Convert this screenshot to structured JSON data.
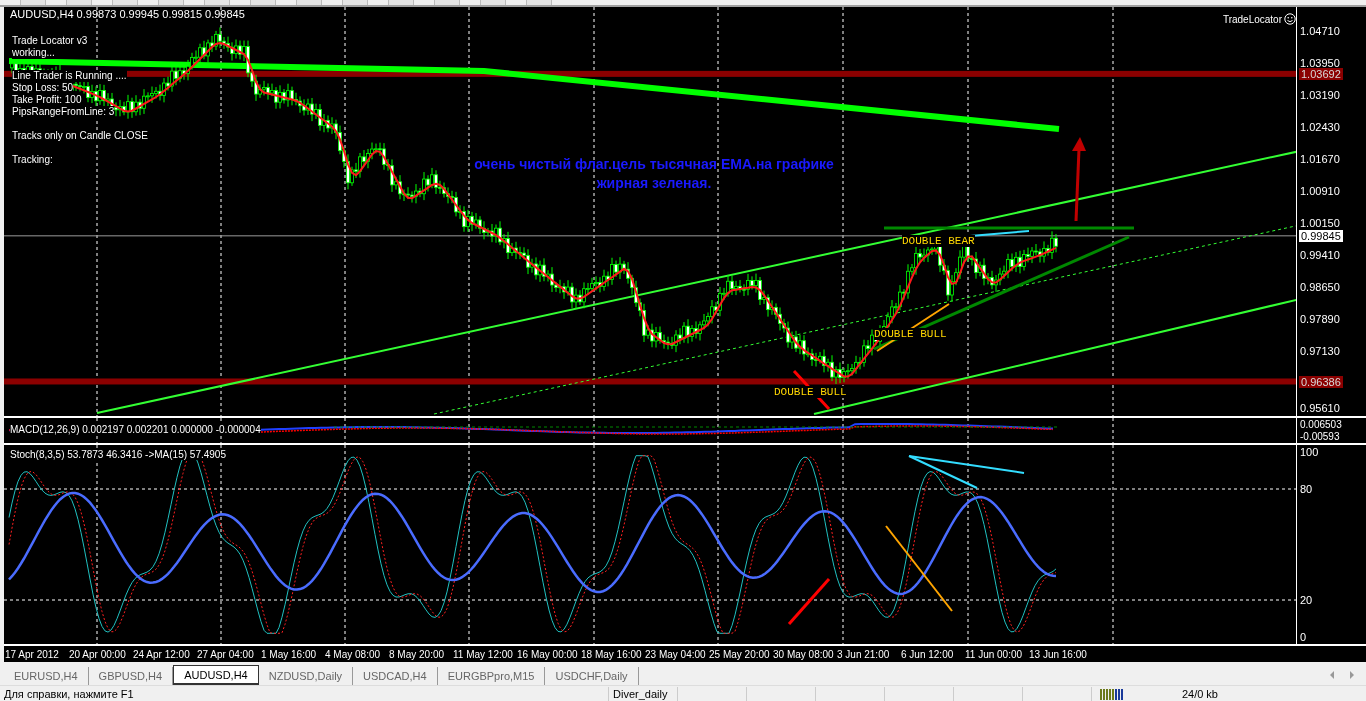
{
  "chart": {
    "title": "AUDUSD,H4  0.99873 0.99945 0.99815 0.99845",
    "info_blocks": [
      [
        "Trade Locator v3",
        "working..."
      ],
      [
        "Line Trader is Running ....",
        "Stop Loss: 50",
        "Take Profit: 100",
        "PipsRangeFromLine: 3"
      ],
      [
        "Tracks only on Candle CLOSE"
      ],
      [
        "Tracking:"
      ]
    ],
    "expert_label": "TradeLocator",
    "annotation": "очень чистый флаг.цель тысячная EMA.на графике жирная зеленая.",
    "pattern_labels": [
      {
        "text": "DOUBLE BEAR"
      },
      {
        "text": "DOUBLE BULL"
      },
      {
        "text": "DOUBLE BULL"
      }
    ],
    "price_axis": {
      "ticks": [
        "1.04710",
        "1.03950",
        "1.03190",
        "1.02430",
        "1.01670",
        "1.00910",
        "1.00150",
        "0.99410",
        "0.98650",
        "0.97890",
        "0.97130",
        "0.95610"
      ],
      "lines": [
        {
          "value": "1.03692",
          "kind": "level"
        },
        {
          "value": "0.99845",
          "kind": "current"
        },
        {
          "value": "0.96386",
          "kind": "level"
        }
      ]
    }
  },
  "macd": {
    "label": "MACD(12,26,9) 0.002197 0.002201 0.000000 -0.000004",
    "axis": [
      "0.006503",
      "-0.00593"
    ]
  },
  "stoch": {
    "label": "Stoch(8,3,5) 53.7873 46.3416  ->MA(15) 57.4905",
    "axis": [
      "100",
      "80",
      "20",
      "0"
    ]
  },
  "time_axis": [
    "17 Apr 2012",
    "20 Apr 00:00",
    "24 Apr 12:00",
    "27 Apr 04:00",
    "1 May 16:00",
    "4 May 08:00",
    "8 May 20:00",
    "11 May 12:00",
    "16 May 00:00",
    "18 May 16:00",
    "23 May 04:00",
    "25 May 20:00",
    "30 May 08:00",
    "3 Jun 21:00",
    "6 Jun 12:00",
    "11 Jun 00:00",
    "13 Jun 16:00"
  ],
  "tabs": [
    {
      "label": "EURUSD,H4",
      "selected": false
    },
    {
      "label": "GBPUSD,H4",
      "selected": false
    },
    {
      "label": "AUDUSD,H4",
      "selected": true
    },
    {
      "label": "NZDUSD,Daily",
      "selected": false
    },
    {
      "label": "USDCAD,H4",
      "selected": false
    },
    {
      "label": "EURGBPpro,M15",
      "selected": false
    },
    {
      "label": "USDCHF,Daily",
      "selected": false
    }
  ],
  "status_bar": {
    "help": "Для справки, нажмите F1",
    "profile": "Diver_daily",
    "traffic": "24/0 kb"
  }
}
